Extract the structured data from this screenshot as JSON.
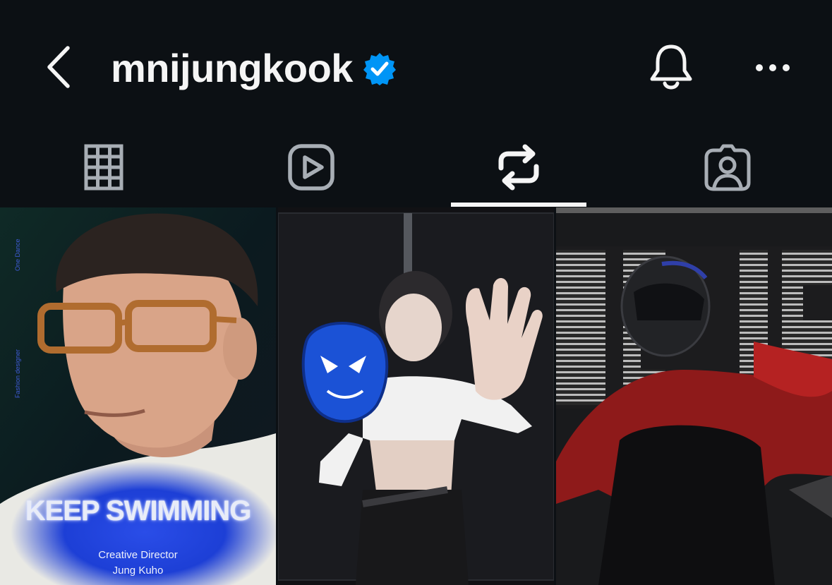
{
  "header": {
    "username": "mnijungkook",
    "verified": true,
    "accent_color": "#0095f6",
    "icons": [
      "back-chevron-icon",
      "verified-badge-icon",
      "bell-icon",
      "more-horizontal-icon"
    ]
  },
  "tabs": [
    {
      "name": "posts",
      "icon": "grid-icon",
      "selected": false
    },
    {
      "name": "reels",
      "icon": "reels-icon",
      "selected": false
    },
    {
      "name": "reposts",
      "icon": "repost-icon",
      "selected": true
    },
    {
      "name": "tagged",
      "icon": "tagged-person-icon",
      "selected": false
    }
  ],
  "posts": [
    {
      "headline": "KEEP SWIMMING",
      "subtitle": "Creative Director",
      "name": "Jung Kuho",
      "side_text_1": "One Dance",
      "side_text_2": "Fashion designer",
      "side_text_3": "Jung Kuho"
    },
    {
      "subject": "blue-mask-photo"
    },
    {
      "subject": "helmet-rider-video"
    }
  ]
}
